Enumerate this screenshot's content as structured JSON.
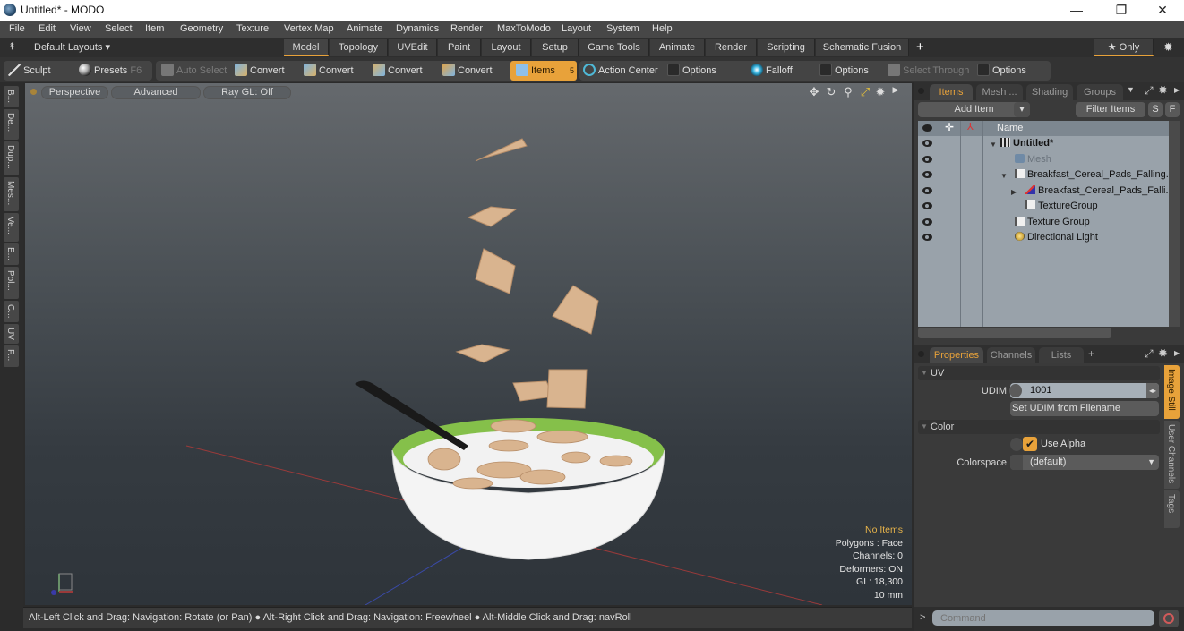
{
  "window": {
    "title": "Untitled* - MODO",
    "controls": {
      "minimize": "—",
      "restore": "❐",
      "close": "✕"
    }
  },
  "menu": [
    "File",
    "Edit",
    "View",
    "Select",
    "Item",
    "Geometry",
    "Texture",
    "Vertex Map",
    "Animate",
    "Dynamics",
    "Render",
    "MaxToModo",
    "Layout",
    "System",
    "Help"
  ],
  "layouts": {
    "dropdown_label": "Default Layouts ▾",
    "tabs": [
      "Model",
      "Topology",
      "UVEdit",
      "Paint",
      "Layout",
      "Setup",
      "Game Tools",
      "Animate",
      "Render",
      "Scripting",
      "Schematic Fusion"
    ],
    "active_tab": "Model",
    "add_label": "+",
    "only_label": "★ Only"
  },
  "toolbar": {
    "sculpt": "Sculpt",
    "presets": "Presets",
    "presets_key": "F6",
    "auto_select": "Auto Select",
    "convert_1": "Convert",
    "convert_2": "Convert",
    "convert_3": "Convert",
    "convert_4": "Convert",
    "items": "Items",
    "items_key": "5",
    "action_center": "Action Center",
    "options_1": "Options",
    "falloff": "Falloff",
    "options_2": "Options",
    "select_through": "Select Through",
    "options_3": "Options"
  },
  "left_tabs": [
    "B...",
    "De...",
    "Dup...",
    "Mes...",
    "Ve...",
    "E...",
    "Pol...",
    "C...",
    "UV",
    "F..."
  ],
  "viewport": {
    "view_mode": "Perspective",
    "shading": "Advanced",
    "raygl": "Ray GL: Off",
    "hud": {
      "selection": "No Items",
      "polygons": "Polygons : Face",
      "channels": "Channels: 0",
      "deformers": "Deformers: ON",
      "gl": "GL: 18,300",
      "unit": "10 mm"
    }
  },
  "status_bar": "Alt-Left Click and Drag: Navigation: Rotate (or Pan) ● Alt-Right Click and Drag: Navigation: Freewheel ● Alt-Middle Click and Drag: navRoll",
  "items_panel": {
    "tabs": [
      "Items",
      "Mesh ...",
      "Shading",
      "Groups"
    ],
    "active_tab": "Items",
    "add_item": "Add Item",
    "filter_items": "Filter Items",
    "s_btn": "S",
    "f_btn": "F",
    "col_name": "Name",
    "rows": [
      {
        "label": "Untitled*",
        "type": "scene"
      },
      {
        "label": "Mesh",
        "type": "mesh"
      },
      {
        "label": "Breakfast_Cereal_Pads_Falling...",
        "type": "group"
      },
      {
        "label": "Breakfast_Cereal_Pads_Falli...",
        "type": "locator"
      },
      {
        "label": "TextureGroup",
        "type": "group"
      },
      {
        "label": "Texture Group",
        "type": "group"
      },
      {
        "label": "Directional Light",
        "type": "light"
      }
    ]
  },
  "properties_panel": {
    "tabs": [
      "Properties",
      "Channels",
      "Lists"
    ],
    "active_tab": "Properties",
    "add_label": "+",
    "uv_section": "UV",
    "udim_label": "UDIM",
    "udim_value": "1001",
    "set_udim_button": "Set UDIM from Filename",
    "color_section": "Color",
    "use_alpha_label": "Use Alpha",
    "use_alpha_checked": true,
    "colorspace_label": "Colorspace",
    "colorspace_value": "(default)",
    "side_tabs": [
      "Image Still",
      "User Channels",
      "Tags"
    ],
    "active_side_tab": "Image Still"
  },
  "command": {
    "placeholder": "Command",
    "prompt": ">"
  },
  "colors": {
    "accent": "#e8a23a",
    "viewport_top": "#65696d",
    "viewport_bottom": "#2e343a",
    "list_bg": "#99a2aa"
  }
}
